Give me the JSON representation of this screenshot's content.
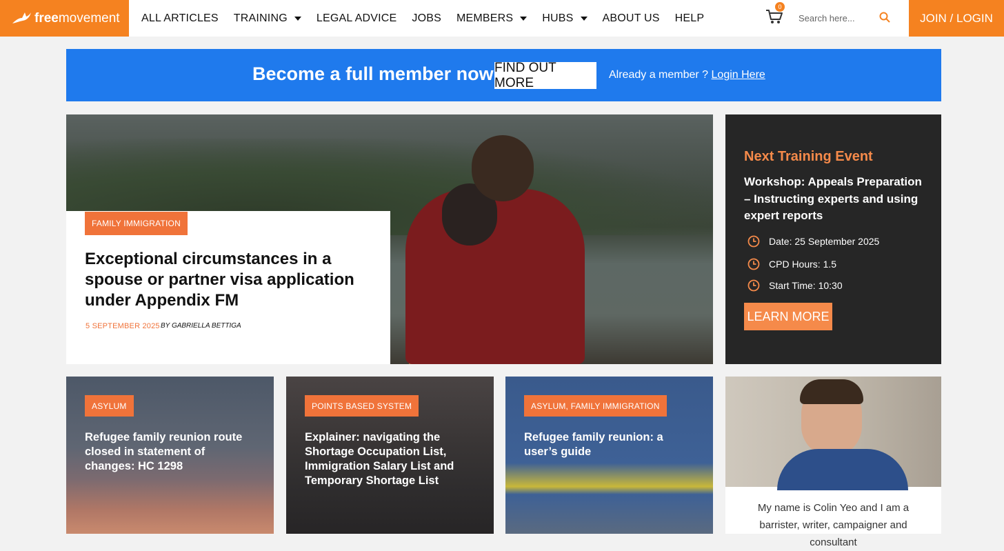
{
  "header": {
    "logo_bold": "free",
    "logo_rest": "movement",
    "nav": [
      {
        "label": "ALL ARTICLES",
        "dropdown": false
      },
      {
        "label": "TRAINING",
        "dropdown": true
      },
      {
        "label": "LEGAL ADVICE",
        "dropdown": false
      },
      {
        "label": "JOBS",
        "dropdown": false
      },
      {
        "label": "MEMBERS",
        "dropdown": true
      },
      {
        "label": "HUBS",
        "dropdown": true
      },
      {
        "label": "ABOUT US",
        "dropdown": false
      },
      {
        "label": "HELP",
        "dropdown": false
      }
    ],
    "cart_count": "0",
    "search_placeholder": "Search here...",
    "join_label": "JOIN / LOGIN"
  },
  "banner": {
    "title": "Become a full member now",
    "button": "FIND OUT MORE",
    "already": "Already a member ?",
    "login_link": "Login Here"
  },
  "hero": {
    "tag": "FAMILY IMMIGRATION",
    "title": "Exceptional circumstances in a spouse or partner visa application under Appendix FM",
    "date": "5 SEPTEMBER 2025",
    "author": "BY GABRIELLA BETTIGA"
  },
  "event": {
    "heading": "Next Training Event",
    "title": "Workshop: Appeals Preparation – Instructing experts and using expert reports",
    "date": "Date: 25 September 2025",
    "cpd": "CPD Hours: 1.5",
    "start": "Start Time: 10:30",
    "button": "LEARN MORE"
  },
  "cards": [
    {
      "tag": "ASYLUM",
      "title": "Refugee family reunion route closed in statement of changes: HC 1298"
    },
    {
      "tag": "POINTS BASED SYSTEM",
      "title": "Explainer: navigating the Shortage Occupation List, Immigration Salary List and Temporary Shortage List"
    },
    {
      "tag": "ASYLUM, FAMILY IMMIGRATION",
      "title": "Refugee family reunion: a user’s guide"
    }
  ],
  "bio": {
    "text": "My name is Colin Yeo and I am a barrister, writer, campaigner and consultant"
  },
  "colors": {
    "brand_orange": "#f58220",
    "banner_blue": "#1f7aed",
    "tag_orange": "#f0733a",
    "event_bg": "#262626"
  }
}
